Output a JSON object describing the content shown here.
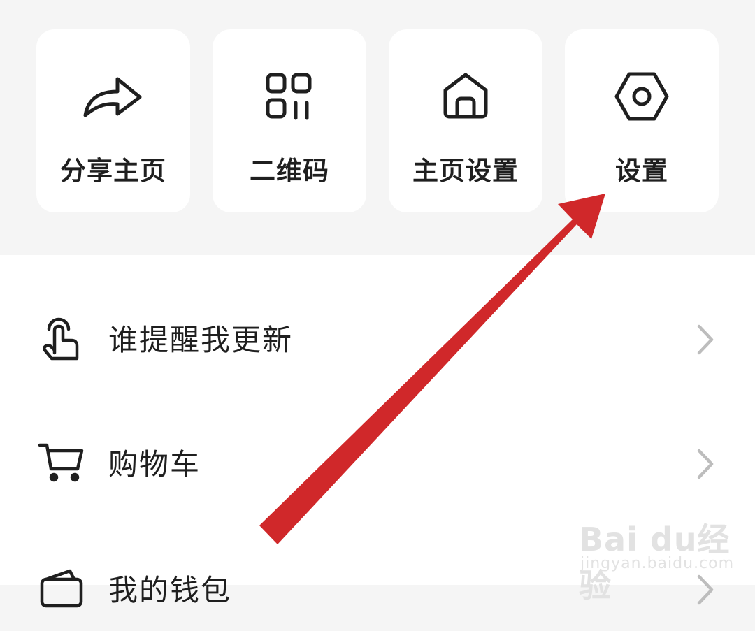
{
  "quick_actions": [
    {
      "label": "分享主页",
      "icon": "share-icon"
    },
    {
      "label": "二维码",
      "icon": "qr-code-icon"
    },
    {
      "label": "主页设置",
      "icon": "home-icon"
    },
    {
      "label": "设置",
      "icon": "settings-icon"
    }
  ],
  "menu": [
    {
      "label": "谁提醒我更新",
      "icon": "tap-hand-icon"
    },
    {
      "label": "购物车",
      "icon": "cart-icon"
    },
    {
      "label": "我的钱包",
      "icon": "wallet-icon"
    }
  ],
  "annotation": {
    "color": "#d0282a"
  },
  "watermark": {
    "logo_text": "Bai du经验",
    "url": "jingyan.baidu.com"
  }
}
